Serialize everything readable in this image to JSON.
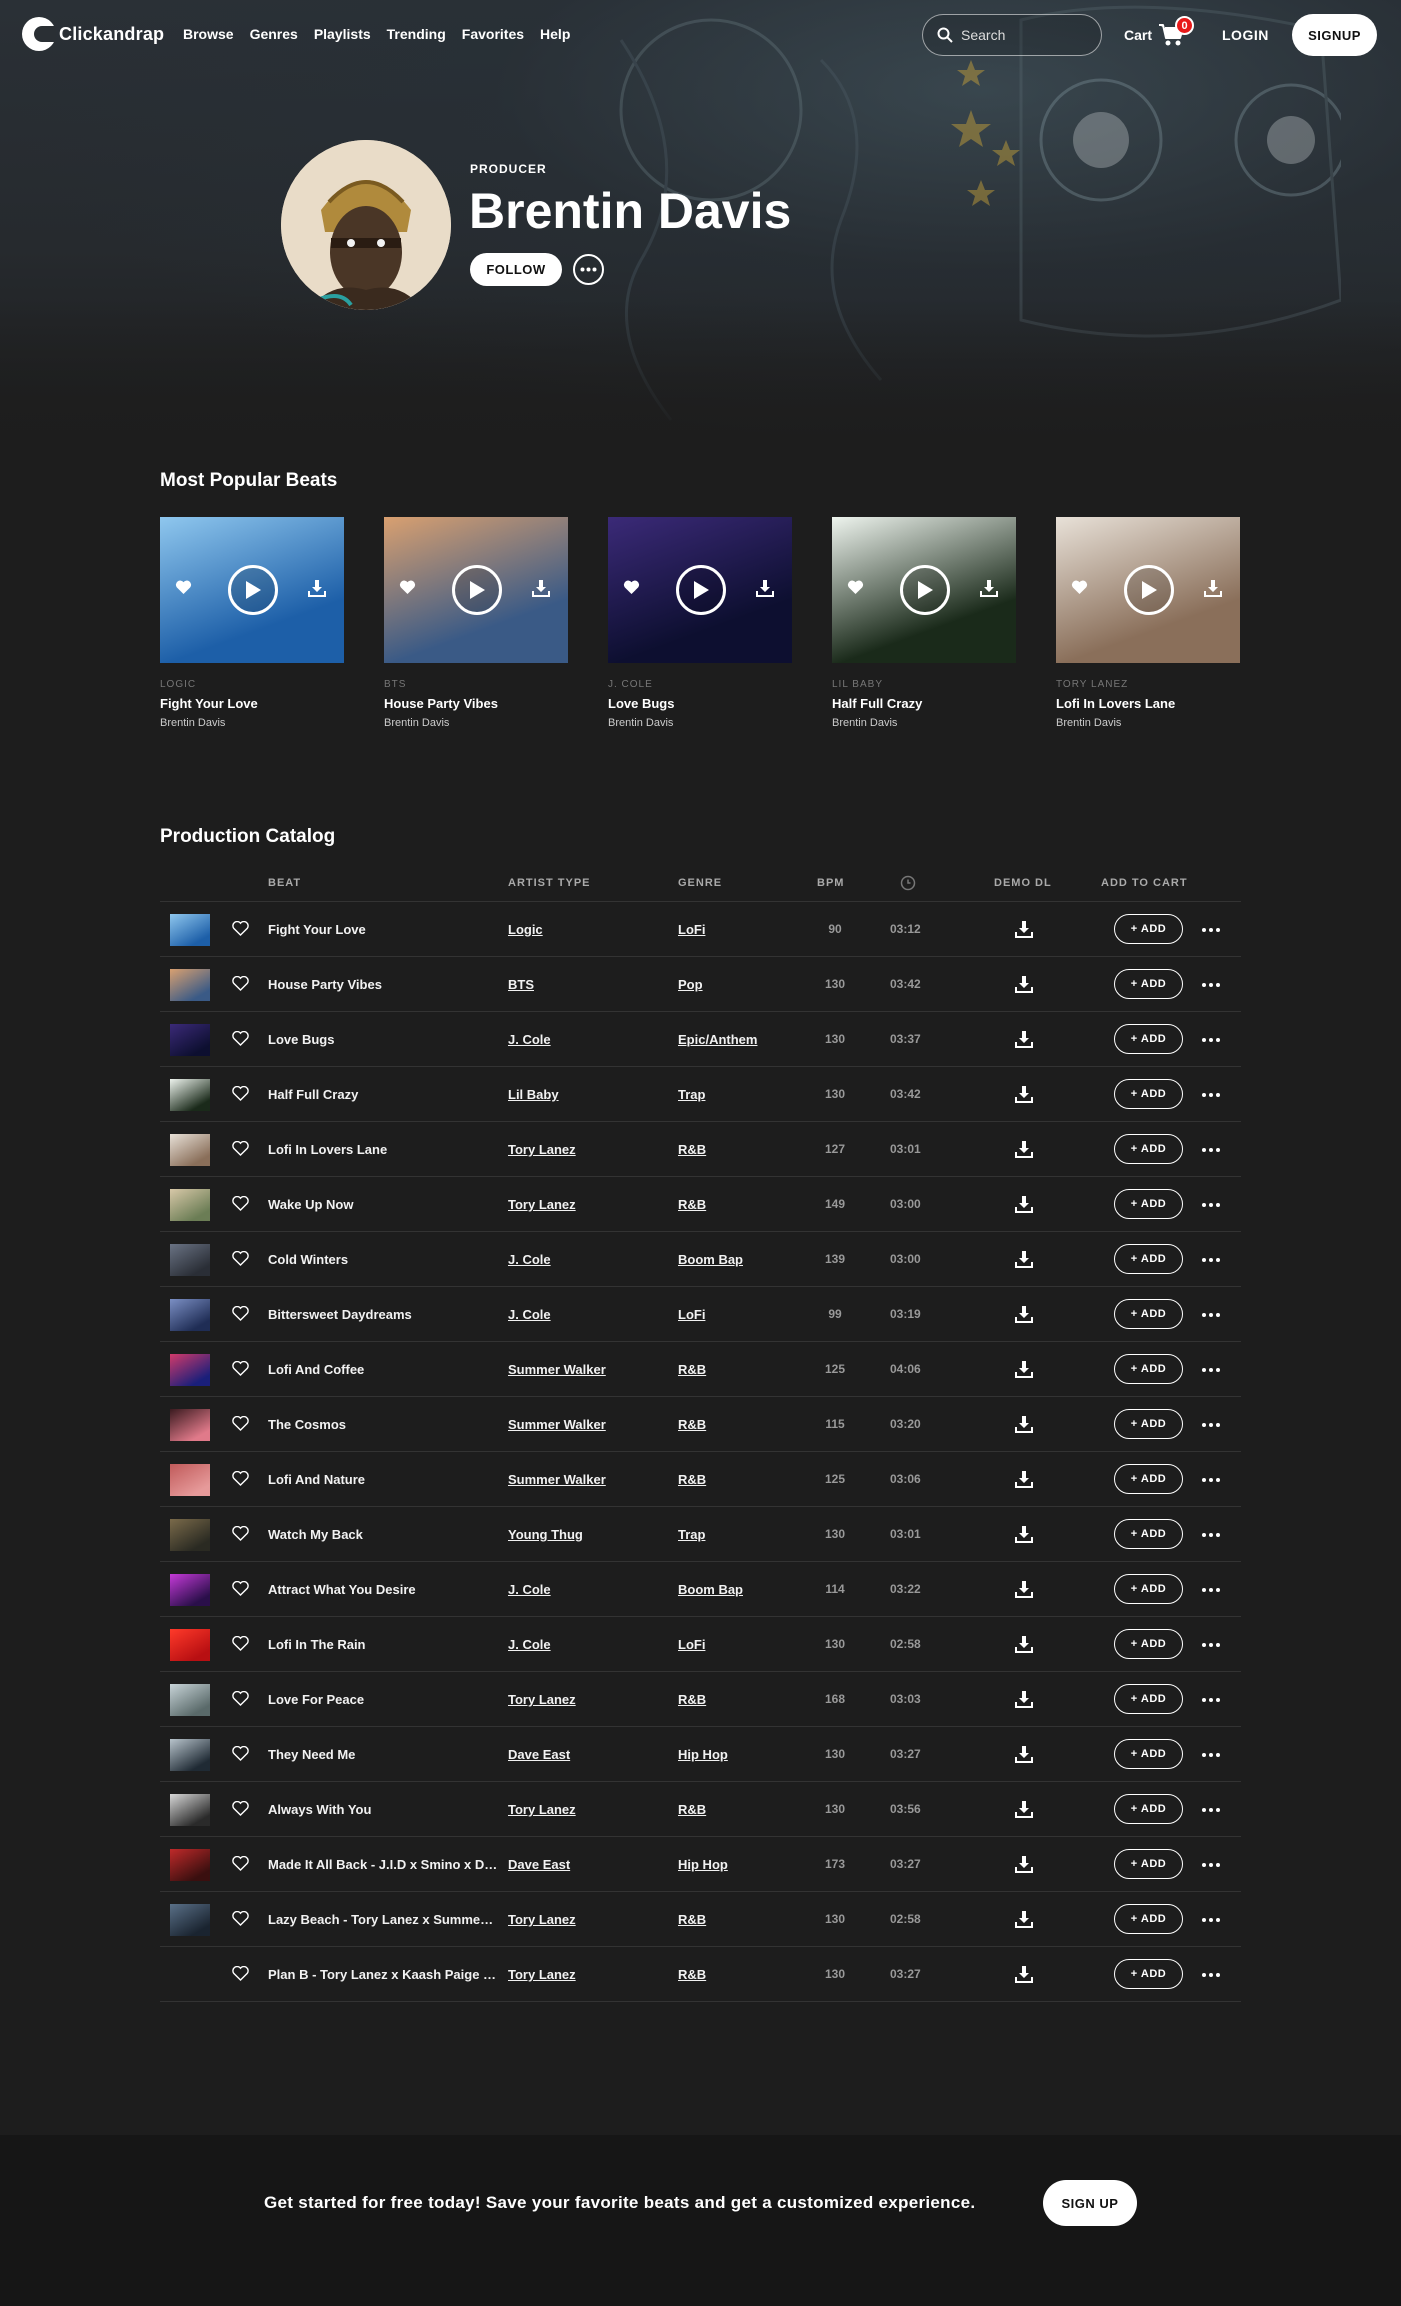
{
  "brand": {
    "name": "Clickandrap"
  },
  "nav": {
    "links": [
      "Browse",
      "Genres",
      "Playlists",
      "Trending",
      "Favorites",
      "Help"
    ],
    "search_placeholder": "Search",
    "cart_label": "Cart",
    "cart_count": "0",
    "login_label": "LOGIN",
    "signup_label": "SIGNUP"
  },
  "profile": {
    "role": "PRODUCER",
    "name": "Brentin Davis",
    "follow_label": "FOLLOW"
  },
  "popular": {
    "heading": "Most Popular Beats",
    "cards": [
      {
        "artist": "LOGIC",
        "title": "Fight Your Love",
        "producer": "Brentin Davis",
        "c1": "#1d5fa8",
        "c2": "#8fc7ee"
      },
      {
        "artist": "BTS",
        "title": "House Party Vibes",
        "producer": "Brentin Davis",
        "c1": "#3a5a86",
        "c2": "#d9a070"
      },
      {
        "artist": "J. COLE",
        "title": "Love Bugs",
        "producer": "Brentin Davis",
        "c1": "#0d0f30",
        "c2": "#3b2a78"
      },
      {
        "artist": "LIL BABY",
        "title": "Half Full Crazy",
        "producer": "Brentin Davis",
        "c1": "#1a2a1a",
        "c2": "#eef4ee"
      },
      {
        "artist": "TORY LANEZ",
        "title": "Lofi In Lovers Lane",
        "producer": "Brentin Davis",
        "c1": "#8a6f5a",
        "c2": "#e8e1d8"
      }
    ]
  },
  "catalog": {
    "heading": "Production Catalog",
    "columns": {
      "beat": "BEAT",
      "artist_type": "ARTIST TYPE",
      "genre": "GENRE",
      "bpm": "BPM",
      "demo_dl": "DEMO DL",
      "add_to_cart": "ADD TO CART"
    },
    "add_label": "+ ADD",
    "rows": [
      {
        "title": "Fight Your Love",
        "artist": "Logic",
        "genre": "LoFi",
        "bpm": "90",
        "duration": "03:12",
        "c1": "#1d5fa8",
        "c2": "#8fc7ee"
      },
      {
        "title": "House Party Vibes",
        "artist": "BTS",
        "genre": "Pop",
        "bpm": "130",
        "duration": "03:42",
        "c1": "#3a5a86",
        "c2": "#d9a070"
      },
      {
        "title": "Love Bugs",
        "artist": "J. Cole",
        "genre": "Epic/Anthem",
        "bpm": "130",
        "duration": "03:37",
        "c1": "#0d0f30",
        "c2": "#3b2a78"
      },
      {
        "title": "Half Full Crazy",
        "artist": "Lil Baby",
        "genre": "Trap",
        "bpm": "130",
        "duration": "03:42",
        "c1": "#1a2a1a",
        "c2": "#eef4ee"
      },
      {
        "title": "Lofi In Lovers Lane",
        "artist": "Tory Lanez",
        "genre": "R&B",
        "bpm": "127",
        "duration": "03:01",
        "c1": "#8a6f5a",
        "c2": "#e8e1d8"
      },
      {
        "title": "Wake Up Now",
        "artist": "Tory Lanez",
        "genre": "R&B",
        "bpm": "149",
        "duration": "03:00",
        "c1": "#6b7d55",
        "c2": "#d8c8a8"
      },
      {
        "title": "Cold Winters",
        "artist": "J. Cole",
        "genre": "Boom Bap",
        "bpm": "139",
        "duration": "03:00",
        "c1": "#2a2e36",
        "c2": "#6a7384"
      },
      {
        "title": "Bittersweet Daydreams",
        "artist": "J. Cole",
        "genre": "LoFi",
        "bpm": "99",
        "duration": "03:19",
        "c1": "#1f2d55",
        "c2": "#7b8fc4"
      },
      {
        "title": "Lofi And Coffee",
        "artist": "Summer Walker",
        "genre": "R&B",
        "bpm": "125",
        "duration": "04:06",
        "c1": "#1a1f7a",
        "c2": "#d23a6a"
      },
      {
        "title": "The Cosmos",
        "artist": "Summer Walker",
        "genre": "R&B",
        "bpm": "115",
        "duration": "03:20",
        "c1": "#e07a8a",
        "c2": "#3a1a1f"
      },
      {
        "title": "Lofi And Nature",
        "artist": "Summer Walker",
        "genre": "R&B",
        "bpm": "125",
        "duration": "03:06",
        "c1": "#e69a9a",
        "c2": "#c05a5a"
      },
      {
        "title": "Watch My Back",
        "artist": "Young Thug",
        "genre": "Trap",
        "bpm": "130",
        "duration": "03:01",
        "c1": "#2a2a22",
        "c2": "#7a6a4a"
      },
      {
        "title": "Attract What You Desire",
        "artist": "J. Cole",
        "genre": "Boom Bap",
        "bpm": "114",
        "duration": "03:22",
        "c1": "#2a0f4a",
        "c2": "#c53ad8"
      },
      {
        "title": "Lofi In The Rain",
        "artist": "J. Cole",
        "genre": "LoFi",
        "bpm": "130",
        "duration": "02:58",
        "c1": "#b80f12",
        "c2": "#ff3a2a"
      },
      {
        "title": "Love For Peace",
        "artist": "Tory Lanez",
        "genre": "R&B",
        "bpm": "168",
        "duration": "03:03",
        "c1": "#5a6a6a",
        "c2": "#c8d4d8"
      },
      {
        "title": "They Need Me",
        "artist": "Dave East",
        "genre": "Hip Hop",
        "bpm": "130",
        "duration": "03:27",
        "c1": "#1f2a34",
        "c2": "#b8c4cc"
      },
      {
        "title": "Always With You",
        "artist": "Tory Lanez",
        "genre": "R&B",
        "bpm": "130",
        "duration": "03:56",
        "c1": "#2a2a2a",
        "c2": "#d8d8d8"
      },
      {
        "title": "Made It All Back - J.I.D x Smino x Dav...",
        "artist": "Dave East",
        "genre": "Hip Hop",
        "bpm": "173",
        "duration": "03:27",
        "c1": "#3a0f0f",
        "c2": "#c02a2a"
      },
      {
        "title": "Lazy Beach - Tory Lanez x Summer Walker",
        "artist": "Tory Lanez",
        "genre": "R&B",
        "bpm": "130",
        "duration": "02:58",
        "c1": "#1a2430",
        "c2": "#5a7088"
      },
      {
        "title": "Plan B - Tory Lanez x Kaash Paige x Summer",
        "artist": "Tory Lanez",
        "genre": "R&B",
        "bpm": "130",
        "duration": "03:27",
        "c1": "",
        "c2": ""
      }
    ]
  },
  "cta": {
    "text": "Get started for free today! Save your favorite beats and get a customized experience.",
    "button_label": "SIGN UP"
  }
}
